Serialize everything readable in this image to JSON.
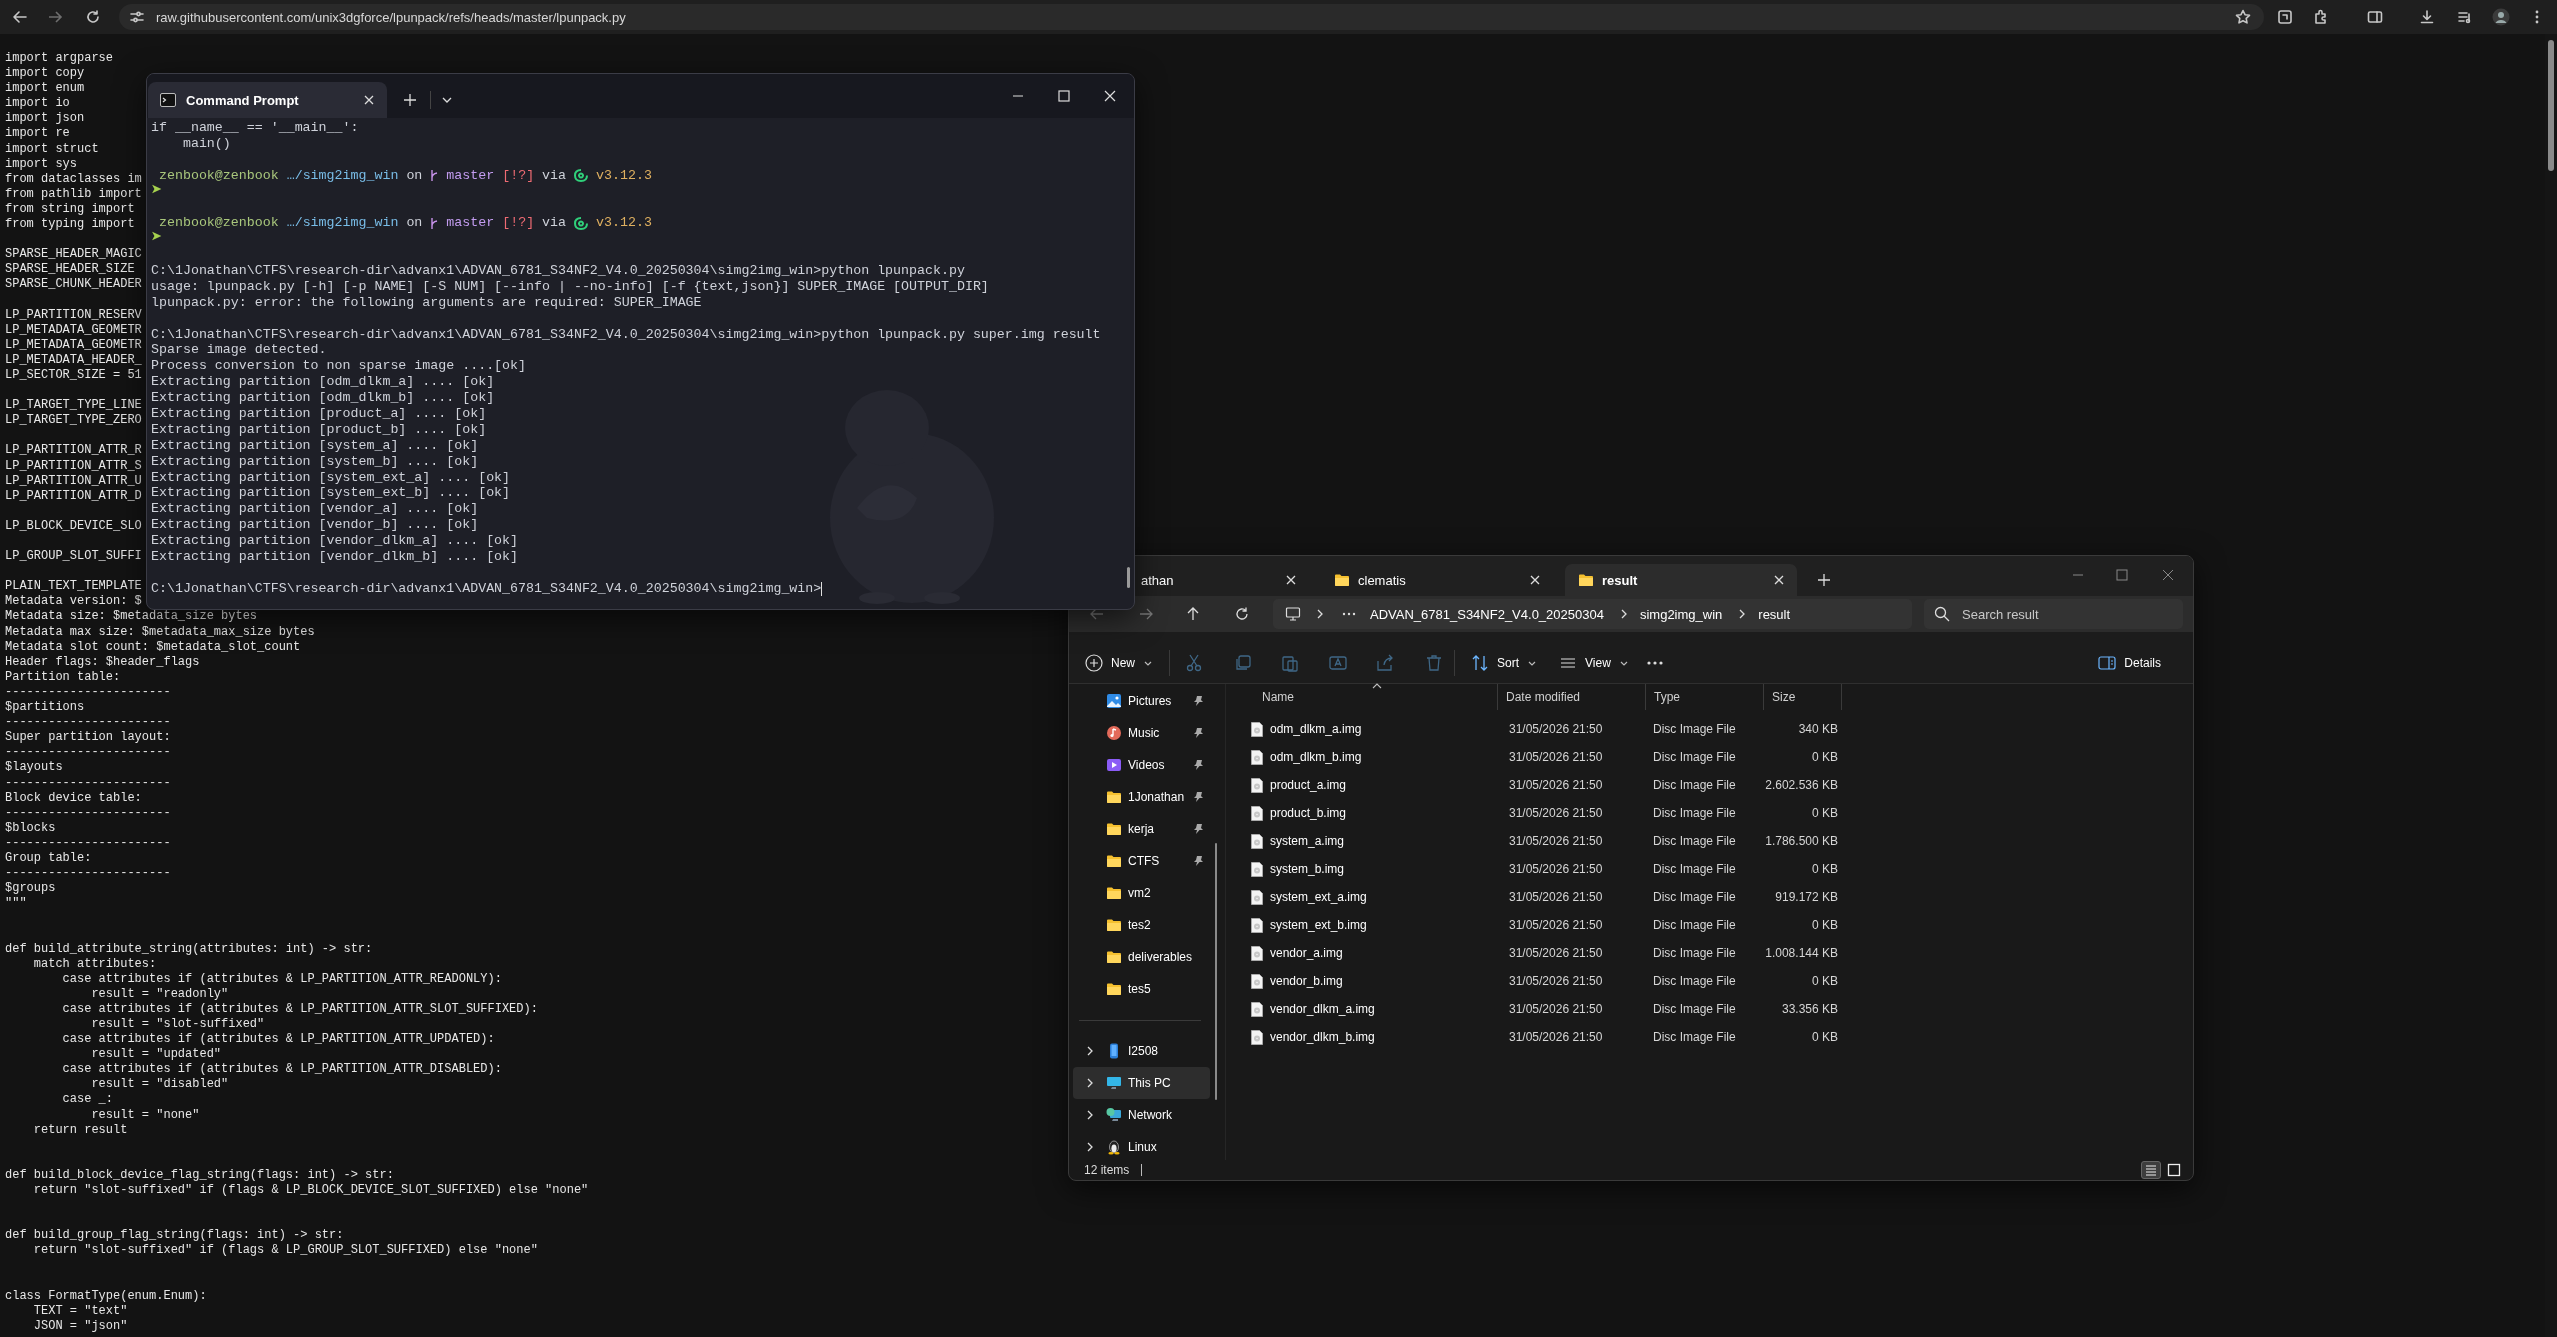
{
  "browser": {
    "url": "raw.githubusercontent.com/unix3dgforce/lpunpack/refs/heads/master/lpunpack.py"
  },
  "source_code": {
    "sections": [
      [
        {
          "lines": [
            "import argparse",
            "import copy",
            "import enum",
            "import io",
            "import json",
            "import re",
            "import struct",
            "import sys",
            "from dataclasses im",
            "from pathlib import",
            "from string import",
            "from typing import"
          ]
        },
        {
          "lines": [
            "SPARSE_HEADER_MAGIC",
            "SPARSE_HEADER_SIZE",
            "SPARSE_CHUNK_HEADER"
          ]
        },
        {
          "lines": [
            "LP_PARTITION_RESERV",
            "LP_METADATA_GEOMETR",
            "LP_METADATA_GEOMETR",
            "LP_METADATA_HEADER_",
            "LP_SECTOR_SIZE = 51"
          ]
        },
        {
          "lines": [
            "LP_TARGET_TYPE_LINE",
            "LP_TARGET_TYPE_ZERO"
          ]
        },
        {
          "lines": [
            "LP_PARTITION_ATTR_R",
            "LP_PARTITION_ATTR_S",
            "LP_PARTITION_ATTR_U",
            "LP_PARTITION_ATTR_D"
          ]
        },
        {
          "lines": [
            "LP_BLOCK_DEVICE_SLO"
          ]
        },
        {
          "lines": [
            "LP_GROUP_SLOT_SUFFI"
          ]
        },
        {
          "lines": [
            "PLAIN_TEXT_TEMPLATE",
            "Metadata version: $",
            "Metadata size: $metadata_size bytes",
            "Metadata max size: $metadata_max_size bytes",
            "Metadata slot count: $metadata_slot_count",
            "Header flags: $header_flags",
            "Partition table:",
            "-----------------------",
            "$partitions",
            "-----------------------",
            "Super partition layout:",
            "-----------------------",
            "$layouts",
            "-----------------------",
            "Block device table:",
            "-----------------------",
            "$blocks",
            "-----------------------",
            "Group table:",
            "-----------------------",
            "$groups",
            "\"\"\""
          ]
        }
      ],
      [
        {
          "lines": [
            "def build_attribute_string(attributes: int) -> str:",
            "    match attributes:",
            "        case attributes if (attributes & LP_PARTITION_ATTR_READONLY):",
            "            result = \"readonly\"",
            "        case attributes if (attributes & LP_PARTITION_ATTR_SLOT_SUFFIXED):",
            "            result = \"slot-suffixed\"",
            "        case attributes if (attributes & LP_PARTITION_ATTR_UPDATED):",
            "            result = \"updated\"",
            "        case attributes if (attributes & LP_PARTITION_ATTR_DISABLED):",
            "            result = \"disabled\"",
            "        case _:",
            "            result = \"none\"",
            "    return result"
          ]
        }
      ],
      [
        {
          "lines": [
            "def build_block_device_flag_string(flags: int) -> str:",
            "    return \"slot-suffixed\" if (flags & LP_BLOCK_DEVICE_SLOT_SUFFIXED) else \"none\""
          ]
        }
      ],
      [
        {
          "lines": [
            "def build_group_flag_string(flags: int) -> str:",
            "    return \"slot-suffixed\" if (flags & LP_GROUP_SLOT_SUFFIXED) else \"none\""
          ]
        }
      ],
      [
        {
          "lines": [
            "class FormatType(enum.Enum):",
            "    TEXT = \"text\"",
            "    JSON = \"json\""
          ]
        }
      ]
    ]
  },
  "terminal": {
    "tabs": [
      {
        "label": "Command Prompt",
        "selected": true
      }
    ],
    "blocks": [
      [
        {
          "kind": "output",
          "text": "if __name__ == '__main__':"
        },
        {
          "kind": "output",
          "text": "    main()"
        }
      ],
      [
        {
          "kind": "prompt",
          "user": "zenbook@zenbook",
          "path": "…/simg2img_win",
          "on": "on",
          "branch": "master",
          "status": "[!?]",
          "via": "via",
          "version": "v3.12.3"
        },
        {
          "kind": "arrow",
          "text": "➤"
        }
      ],
      [
        {
          "kind": "prompt",
          "user": "zenbook@zenbook",
          "path": "…/simg2img_win",
          "on": "on",
          "branch": "master",
          "status": "[!?]",
          "via": "via",
          "version": "v3.12.3"
        },
        {
          "kind": "arrow",
          "text": "➤"
        }
      ],
      [
        {
          "kind": "output",
          "text": "C:\\1Jonathan\\CTFS\\research-dir\\advanx1\\ADVAN_6781_S34NF2_V4.0_20250304\\simg2img_win>python lpunpack.py"
        },
        {
          "kind": "output",
          "text": "usage: lpunpack.py [-h] [-p NAME] [-S NUM] [--info | --no-info] [-f {text,json}] SUPER_IMAGE [OUTPUT_DIR]"
        },
        {
          "kind": "output",
          "text": "lpunpack.py: error: the following arguments are required: SUPER_IMAGE"
        }
      ],
      [
        {
          "kind": "output",
          "text": "C:\\1Jonathan\\CTFS\\research-dir\\advanx1\\ADVAN_6781_S34NF2_V4.0_20250304\\simg2img_win>python lpunpack.py super.img result"
        },
        {
          "kind": "output",
          "text": "Sparse image detected."
        },
        {
          "kind": "output",
          "text": "Process conversion to non sparse image ....[ok]"
        },
        {
          "kind": "output",
          "text": "Extracting partition [odm_dlkm_a] .... [ok]"
        },
        {
          "kind": "output",
          "text": "Extracting partition [odm_dlkm_b] .... [ok]"
        },
        {
          "kind": "output",
          "text": "Extracting partition [product_a] .... [ok]"
        },
        {
          "kind": "output",
          "text": "Extracting partition [product_b] .... [ok]"
        },
        {
          "kind": "output",
          "text": "Extracting partition [system_a] .... [ok]"
        },
        {
          "kind": "output",
          "text": "Extracting partition [system_b] .... [ok]"
        },
        {
          "kind": "output",
          "text": "Extracting partition [system_ext_a] .... [ok]"
        },
        {
          "kind": "output",
          "text": "Extracting partition [system_ext_b] .... [ok]"
        },
        {
          "kind": "output",
          "text": "Extracting partition [vendor_a] .... [ok]"
        },
        {
          "kind": "output",
          "text": "Extracting partition [vendor_b] .... [ok]"
        },
        {
          "kind": "output",
          "text": "Extracting partition [vendor_dlkm_a] .... [ok]"
        },
        {
          "kind": "output",
          "text": "Extracting partition [vendor_dlkm_b] .... [ok]"
        }
      ],
      [
        {
          "kind": "input",
          "text": "C:\\1Jonathan\\CTFS\\research-dir\\advanx1\\ADVAN_6781_S34NF2_V4.0_20250304\\simg2img_win>"
        }
      ]
    ]
  },
  "file_explorer": {
    "tabs": [
      {
        "label": "athan",
        "selected": false
      },
      {
        "label": "clematis",
        "selected": false
      },
      {
        "label": "result",
        "selected": true
      }
    ],
    "breadcrumb": [
      "ADVAN_6781_S34NF2_V4.0_20250304",
      "simg2img_win",
      "result"
    ],
    "search": {
      "placeholder": "Search result"
    },
    "toolbar": {
      "new": "New",
      "sort": "Sort",
      "view": "View",
      "details": "Details"
    },
    "sidebar": {
      "quick_access": [
        {
          "kind": "pictures",
          "label": "Pictures",
          "pinned": true
        },
        {
          "kind": "music",
          "label": "Music",
          "pinned": true
        },
        {
          "kind": "videos",
          "label": "Videos",
          "pinned": true
        },
        {
          "kind": "folder",
          "label": "1Jonathan",
          "pinned": true
        },
        {
          "kind": "folder",
          "label": "kerja",
          "pinned": true
        },
        {
          "kind": "folder",
          "label": "CTFS",
          "pinned": true
        },
        {
          "kind": "folder",
          "label": "vm2",
          "pinned": false
        },
        {
          "kind": "folder",
          "label": "tes2",
          "pinned": false
        },
        {
          "kind": "folder",
          "label": "deliverables",
          "pinned": false
        },
        {
          "kind": "folder",
          "label": "tes5",
          "pinned": false
        }
      ],
      "locations": [
        {
          "kind": "phone",
          "label": "I2508",
          "selected": false
        },
        {
          "kind": "pc",
          "label": "This PC",
          "selected": true
        },
        {
          "kind": "network",
          "label": "Network",
          "selected": false
        },
        {
          "kind": "linux",
          "label": "Linux",
          "selected": false
        }
      ]
    },
    "columns": [
      {
        "label": "Name",
        "sorted": true
      },
      {
        "label": "Date modified",
        "sorted": false
      },
      {
        "label": "Type",
        "sorted": false
      },
      {
        "label": "Size",
        "sorted": false
      }
    ],
    "files": [
      {
        "name": "odm_dlkm_a.img",
        "date_modified": "31/05/2026 21:50",
        "type": "Disc Image File",
        "size": "340 KB"
      },
      {
        "name": "odm_dlkm_b.img",
        "date_modified": "31/05/2026 21:50",
        "type": "Disc Image File",
        "size": "0 KB"
      },
      {
        "name": "product_a.img",
        "date_modified": "31/05/2026 21:50",
        "type": "Disc Image File",
        "size": "2.602.536 KB"
      },
      {
        "name": "product_b.img",
        "date_modified": "31/05/2026 21:50",
        "type": "Disc Image File",
        "size": "0 KB"
      },
      {
        "name": "system_a.img",
        "date_modified": "31/05/2026 21:50",
        "type": "Disc Image File",
        "size": "1.786.500 KB"
      },
      {
        "name": "system_b.img",
        "date_modified": "31/05/2026 21:50",
        "type": "Disc Image File",
        "size": "0 KB"
      },
      {
        "name": "system_ext_a.img",
        "date_modified": "31/05/2026 21:50",
        "type": "Disc Image File",
        "size": "919.172 KB"
      },
      {
        "name": "system_ext_b.img",
        "date_modified": "31/05/2026 21:50",
        "type": "Disc Image File",
        "size": "0 KB"
      },
      {
        "name": "vendor_a.img",
        "date_modified": "31/05/2026 21:50",
        "type": "Disc Image File",
        "size": "1.008.144 KB"
      },
      {
        "name": "vendor_b.img",
        "date_modified": "31/05/2026 21:50",
        "type": "Disc Image File",
        "size": "0 KB"
      },
      {
        "name": "vendor_dlkm_a.img",
        "date_modified": "31/05/2026 21:50",
        "type": "Disc Image File",
        "size": "33.356 KB"
      },
      {
        "name": "vendor_dlkm_b.img",
        "date_modified": "31/05/2026 21:50",
        "type": "Disc Image File",
        "size": "0 KB"
      }
    ],
    "status_bar": {
      "item_count": "12 items"
    },
    "views": [
      {
        "kind": "details",
        "selected": true
      },
      {
        "kind": "tiles",
        "selected": false
      }
    ]
  }
}
